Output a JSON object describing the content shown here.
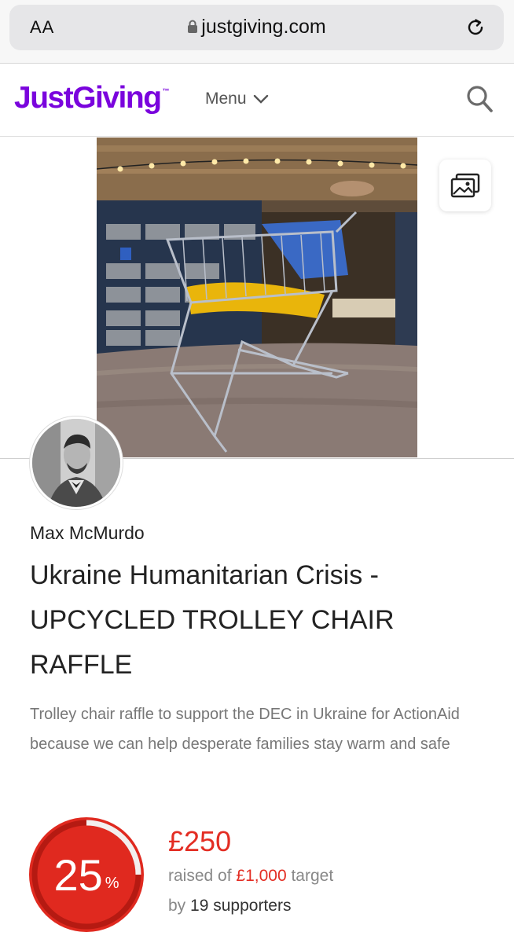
{
  "browser": {
    "text_size_label": "AA",
    "url": "justgiving.com"
  },
  "header": {
    "logo": "JustGiving",
    "logo_tm": "™",
    "menu_label": "Menu"
  },
  "page": {
    "fundraiser_name": "Max McMurdo",
    "title": "Ukraine Humanitarian Crisis - UPCYCLED TROLLEY CHAIR RAFFLE",
    "description": "Trolley chair raffle to support the DEC in Ukraine for ActionAid because we can help desperate families stay warm and safe"
  },
  "progress": {
    "percent": "25",
    "percent_sign": "%",
    "percent_value": 0.25,
    "raised": "£250",
    "raised_of_label": "raised of",
    "target_amount": "£1,000",
    "target_label": "target",
    "by_label": "by",
    "supporters_count": "19 supporters"
  },
  "colors": {
    "brand": "#7a04dd",
    "accent": "#e32d23"
  },
  "icons": [
    "lock-icon",
    "reload-icon",
    "chevron-down-icon",
    "search-icon",
    "gallery-icon"
  ]
}
